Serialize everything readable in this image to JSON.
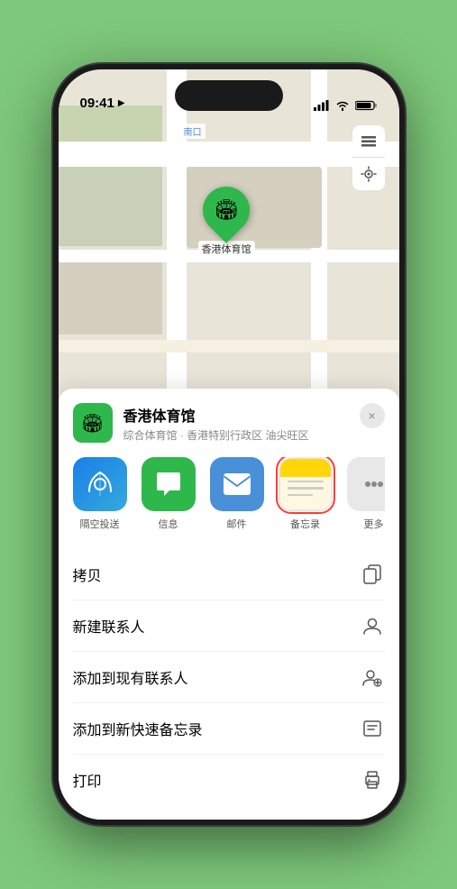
{
  "status_bar": {
    "time": "09:41",
    "location_arrow": "▶"
  },
  "map": {
    "label_south": "南口",
    "stadium_label": "香港体育馆"
  },
  "map_controls": {
    "layers_icon": "🗺",
    "location_icon": "⬆"
  },
  "sheet": {
    "title": "香港体育馆",
    "subtitle": "综合体育馆 · 香港特别行政区 油尖旺区",
    "close_label": "×"
  },
  "apps": [
    {
      "id": "airdrop",
      "label": "隔空投送",
      "icon_type": "airdrop"
    },
    {
      "id": "messages",
      "label": "信息",
      "icon_type": "messages"
    },
    {
      "id": "mail",
      "label": "邮件",
      "icon_type": "mail"
    },
    {
      "id": "notes",
      "label": "备忘录",
      "icon_type": "notes",
      "highlighted": true
    },
    {
      "id": "more",
      "label": "更多",
      "icon_type": "more"
    }
  ],
  "actions": [
    {
      "id": "copy",
      "label": "拷贝",
      "icon": "copy"
    },
    {
      "id": "new-contact",
      "label": "新建联系人",
      "icon": "person"
    },
    {
      "id": "add-existing",
      "label": "添加到现有联系人",
      "icon": "person-add"
    },
    {
      "id": "quick-note",
      "label": "添加到新快速备忘录",
      "icon": "note"
    },
    {
      "id": "print",
      "label": "打印",
      "icon": "print"
    }
  ]
}
